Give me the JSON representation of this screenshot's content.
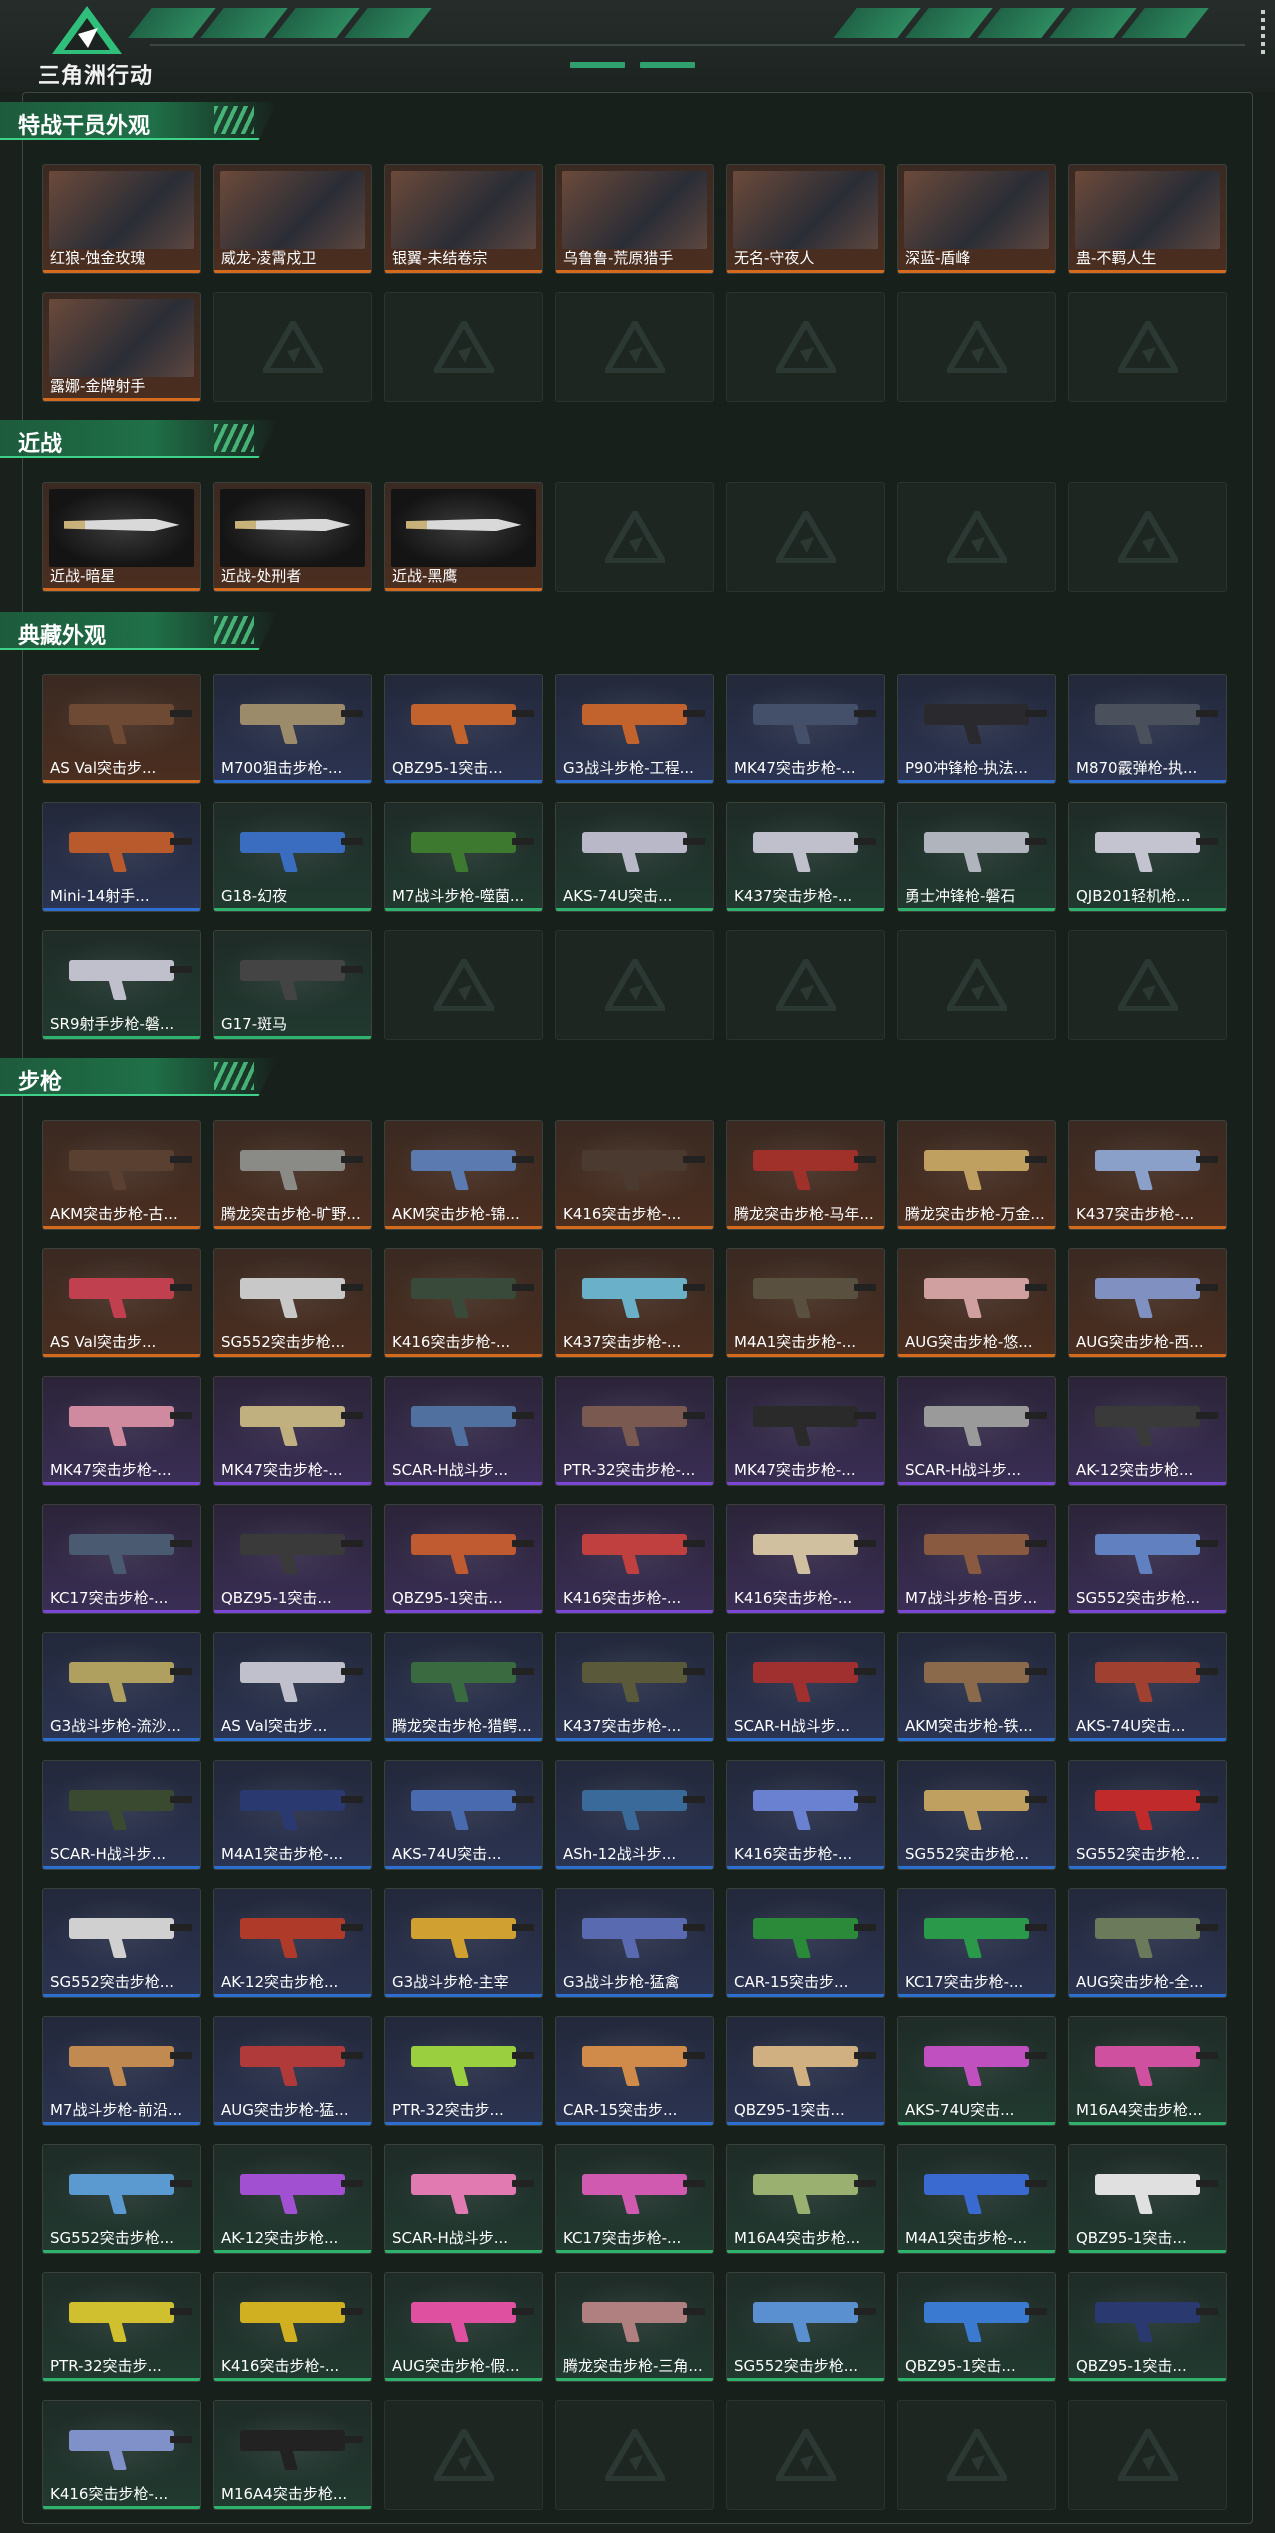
{
  "header": {
    "brand": "三角洲行动",
    "logo_icon": "delta-logo-icon"
  },
  "sections": [
    {
      "title": "特战干员外观",
      "items": [
        {
          "name": "红狼-蚀金玫瑰",
          "quality": "orange",
          "kind": "operator"
        },
        {
          "name": "威龙-凌霄戍卫",
          "quality": "orange",
          "kind": "operator"
        },
        {
          "name": "银翼-未结卷宗",
          "quality": "orange",
          "kind": "operator"
        },
        {
          "name": "乌鲁鲁-荒原猎手",
          "quality": "orange",
          "kind": "operator"
        },
        {
          "name": "无名-守夜人",
          "quality": "orange",
          "kind": "operator"
        },
        {
          "name": "深蓝-盾峰",
          "quality": "orange",
          "kind": "operator"
        },
        {
          "name": "蛊-不羁人生",
          "quality": "orange",
          "kind": "operator"
        },
        {
          "name": "露娜-金牌射手",
          "quality": "orange",
          "kind": "operator"
        }
      ],
      "slots": 14
    },
    {
      "title": "近战",
      "items": [
        {
          "name": "近战-暗星",
          "quality": "orange",
          "kind": "melee"
        },
        {
          "name": "近战-处刑者",
          "quality": "orange",
          "kind": "melee"
        },
        {
          "name": "近战-黑鹰",
          "quality": "orange",
          "kind": "melee"
        }
      ],
      "slots": 7
    },
    {
      "title": "典藏外观",
      "items": [
        {
          "name": "AS Val突击步...",
          "quality": "orange",
          "kind": "gun",
          "color": "#6e4a34"
        },
        {
          "name": "M700狙击步枪-...",
          "quality": "blue",
          "kind": "gun",
          "color": "#9c8b6a"
        },
        {
          "name": "QBZ95-1突击...",
          "quality": "blue",
          "kind": "gun",
          "color": "#c2622c"
        },
        {
          "name": "G3战斗步枪-工程...",
          "quality": "blue",
          "kind": "gun",
          "color": "#c2622c"
        },
        {
          "name": "MK47突击步枪-...",
          "quality": "blue",
          "kind": "gun",
          "color": "#44506a"
        },
        {
          "name": "P90冲锋枪-执法...",
          "quality": "blue",
          "kind": "gun",
          "color": "#2a2a2e"
        },
        {
          "name": "M870霰弹枪-执...",
          "quality": "blue",
          "kind": "gun",
          "color": "#4a505c"
        },
        {
          "name": "Mini-14射手...",
          "quality": "blue",
          "kind": "gun",
          "color": "#b85a2c"
        },
        {
          "name": "G18-幻夜",
          "quality": "green",
          "kind": "gun",
          "color": "#3a6cc0"
        },
        {
          "name": "M7战斗步枪-噬菌...",
          "quality": "green",
          "kind": "gun",
          "color": "#3d7a30"
        },
        {
          "name": "AKS-74U突击...",
          "quality": "green",
          "kind": "gun",
          "color": "#b8b8c8"
        },
        {
          "name": "K437突击步枪-...",
          "quality": "green",
          "kind": "gun",
          "color": "#c0c0cc"
        },
        {
          "name": "勇士冲锋枪-磐石",
          "quality": "green",
          "kind": "gun",
          "color": "#b0b4bc"
        },
        {
          "name": "QJB201轻机枪...",
          "quality": "green",
          "kind": "gun",
          "color": "#c4c4d0"
        },
        {
          "name": "SR9射手步枪-磐...",
          "quality": "green",
          "kind": "gun",
          "color": "#c0c0cc"
        },
        {
          "name": "G17-斑马",
          "quality": "green",
          "kind": "gun",
          "color": "#444444"
        }
      ],
      "slots": 21
    },
    {
      "title": "步枪",
      "items": [
        {
          "name": "AKM突击步枪-古...",
          "quality": "orange",
          "kind": "gun",
          "color": "#5a4030"
        },
        {
          "name": "腾龙突击步枪-旷野...",
          "quality": "orange",
          "kind": "gun",
          "color": "#8a8a86"
        },
        {
          "name": "AKM突击步枪-锦...",
          "quality": "orange",
          "kind": "gun",
          "color": "#5a7ab0"
        },
        {
          "name": "K416突击步枪-...",
          "quality": "orange",
          "kind": "gun",
          "color": "#4a3a30"
        },
        {
          "name": "腾龙突击步枪-马年...",
          "quality": "orange",
          "kind": "gun",
          "color": "#a0302a"
        },
        {
          "name": "腾龙突击步枪-万金...",
          "quality": "orange",
          "kind": "gun",
          "color": "#c0a060"
        },
        {
          "name": "K437突击步枪-...",
          "quality": "orange",
          "kind": "gun",
          "color": "#8aa0c8"
        },
        {
          "name": "AS Val突击步...",
          "quality": "orange",
          "kind": "gun",
          "color": "#c04050"
        },
        {
          "name": "SG552突击步枪...",
          "quality": "orange",
          "kind": "gun",
          "color": "#c8c8c8"
        },
        {
          "name": "K416突击步枪-...",
          "quality": "orange",
          "kind": "gun",
          "color": "#3a4a3a"
        },
        {
          "name": "K437突击步枪-...",
          "quality": "orange",
          "kind": "gun",
          "color": "#6ab0c8"
        },
        {
          "name": "M4A1突击步枪-...",
          "quality": "orange",
          "kind": "gun",
          "color": "#5a5040"
        },
        {
          "name": "AUG突击步枪-悠...",
          "quality": "orange",
          "kind": "gun",
          "color": "#d0a0a0"
        },
        {
          "name": "AUG突击步枪-西...",
          "quality": "orange",
          "kind": "gun",
          "color": "#8090c0"
        },
        {
          "name": "MK47突击步枪-...",
          "quality": "purple",
          "kind": "gun",
          "color": "#d08aa0"
        },
        {
          "name": "MK47突击步枪-...",
          "quality": "purple",
          "kind": "gun",
          "color": "#c0b080"
        },
        {
          "name": "SCAR-H战斗步...",
          "quality": "purple",
          "kind": "gun",
          "color": "#5070a0"
        },
        {
          "name": "PTR-32突击步枪-...",
          "quality": "purple",
          "kind": "gun",
          "color": "#7a5a50"
        },
        {
          "name": "MK47突击步枪-...",
          "quality": "purple",
          "kind": "gun",
          "color": "#2a2a2a"
        },
        {
          "name": "SCAR-H战斗步...",
          "quality": "purple",
          "kind": "gun",
          "color": "#9a9a9a"
        },
        {
          "name": "AK-12突击步枪...",
          "quality": "purple",
          "kind": "gun",
          "color": "#3a3a3a"
        },
        {
          "name": "KC17突击步枪-...",
          "quality": "purple",
          "kind": "gun",
          "color": "#4a5a70"
        },
        {
          "name": "QBZ95-1突击...",
          "quality": "purple",
          "kind": "gun",
          "color": "#3a3a3a"
        },
        {
          "name": "QBZ95-1突击...",
          "quality": "purple",
          "kind": "gun",
          "color": "#c05a30"
        },
        {
          "name": "K416突击步枪-...",
          "quality": "purple",
          "kind": "gun",
          "color": "#c04040"
        },
        {
          "name": "K416突击步枪-...",
          "quality": "purple",
          "kind": "gun",
          "color": "#d0c0a0"
        },
        {
          "name": "M7战斗步枪-百步...",
          "quality": "purple",
          "kind": "gun",
          "color": "#8a5a40"
        },
        {
          "name": "SG552突击步枪...",
          "quality": "purple",
          "kind": "gun",
          "color": "#6080c0"
        },
        {
          "name": "G3战斗步枪-流沙...",
          "quality": "blue",
          "kind": "gun",
          "color": "#b0a060"
        },
        {
          "name": "AS Val突击步...",
          "quality": "blue",
          "kind": "gun",
          "color": "#c0c0cc"
        },
        {
          "name": "腾龙突击步枪-猎鳄...",
          "quality": "blue",
          "kind": "gun",
          "color": "#3a6a40"
        },
        {
          "name": "K437突击步枪-...",
          "quality": "blue",
          "kind": "gun",
          "color": "#5a5a3a"
        },
        {
          "name": "SCAR-H战斗步...",
          "quality": "blue",
          "kind": "gun",
          "color": "#a03030"
        },
        {
          "name": "AKM突击步枪-铁...",
          "quality": "blue",
          "kind": "gun",
          "color": "#8a6a4a"
        },
        {
          "name": "AKS-74U突击...",
          "quality": "blue",
          "kind": "gun",
          "color": "#a04030"
        },
        {
          "name": "SCAR-H战斗步...",
          "quality": "blue",
          "kind": "gun",
          "color": "#3a4a30"
        },
        {
          "name": "M4A1突击步枪-...",
          "quality": "blue",
          "kind": "gun",
          "color": "#2a3a70"
        },
        {
          "name": "AKS-74U突击...",
          "quality": "blue",
          "kind": "gun",
          "color": "#4a6ab0"
        },
        {
          "name": "ASh-12战斗步...",
          "quality": "blue",
          "kind": "gun",
          "color": "#3a6a9a"
        },
        {
          "name": "K416突击步枪-...",
          "quality": "blue",
          "kind": "gun",
          "color": "#6a80d0"
        },
        {
          "name": "SG552突击步枪...",
          "quality": "blue",
          "kind": "gun",
          "color": "#c0a060"
        },
        {
          "name": "SG552突击步枪...",
          "quality": "blue",
          "kind": "gun",
          "color": "#c02a2a"
        },
        {
          "name": "SG552突击步枪...",
          "quality": "blue",
          "kind": "gun",
          "color": "#d0d0d0"
        },
        {
          "name": "AK-12突击步枪...",
          "quality": "blue",
          "kind": "gun",
          "color": "#b03a2a"
        },
        {
          "name": "G3战斗步枪-主宰",
          "quality": "blue",
          "kind": "gun",
          "color": "#d0a030"
        },
        {
          "name": "G3战斗步枪-猛禽",
          "quality": "blue",
          "kind": "gun",
          "color": "#5a6ab0"
        },
        {
          "name": "CAR-15突击步...",
          "quality": "blue",
          "kind": "gun",
          "color": "#2a8a3a"
        },
        {
          "name": "KC17突击步枪-...",
          "quality": "blue",
          "kind": "gun",
          "color": "#2a9a4a"
        },
        {
          "name": "AUG突击步枪-全...",
          "quality": "blue",
          "kind": "gun",
          "color": "#6a7a5a"
        },
        {
          "name": "M7战斗步枪-前沿...",
          "quality": "blue",
          "kind": "gun",
          "color": "#c08a50"
        },
        {
          "name": "AUG突击步枪-猛...",
          "quality": "blue",
          "kind": "gun",
          "color": "#b03a3a"
        },
        {
          "name": "PTR-32突击步...",
          "quality": "blue",
          "kind": "gun",
          "color": "#9ad040"
        },
        {
          "name": "CAR-15突击步...",
          "quality": "blue",
          "kind": "gun",
          "color": "#d08a4a"
        },
        {
          "name": "QBZ95-1突击...",
          "quality": "blue",
          "kind": "gun",
          "color": "#d0b080"
        },
        {
          "name": "AKS-74U突击...",
          "quality": "green",
          "kind": "gun",
          "color": "#c050c0"
        },
        {
          "name": "M16A4突击步枪...",
          "quality": "green",
          "kind": "gun",
          "color": "#d050a0"
        },
        {
          "name": "SG552突击步枪...",
          "quality": "green",
          "kind": "gun",
          "color": "#5a9ad0"
        },
        {
          "name": "AK-12突击步枪...",
          "quality": "green",
          "kind": "gun",
          "color": "#a050d0"
        },
        {
          "name": "SCAR-H战斗步...",
          "quality": "green",
          "kind": "gun",
          "color": "#e07ab0"
        },
        {
          "name": "KC17突击步枪-...",
          "quality": "green",
          "kind": "gun",
          "color": "#d05ab0"
        },
        {
          "name": "M16A4突击步枪...",
          "quality": "green",
          "kind": "gun",
          "color": "#9ab070"
        },
        {
          "name": "M4A1突击步枪-...",
          "quality": "green",
          "kind": "gun",
          "color": "#3a6ad0"
        },
        {
          "name": "QBZ95-1突击...",
          "quality": "green",
          "kind": "gun",
          "color": "#e0e0e0"
        },
        {
          "name": "PTR-32突击步...",
          "quality": "green",
          "kind": "gun",
          "color": "#d0c030"
        },
        {
          "name": "K416突击步枪-...",
          "quality": "green",
          "kind": "gun",
          "color": "#d0b020"
        },
        {
          "name": "AUG突击步枪-假...",
          "quality": "green",
          "kind": "gun",
          "color": "#e050a0"
        },
        {
          "name": "腾龙突击步枪-三角...",
          "quality": "green",
          "kind": "gun",
          "color": "#b08080"
        },
        {
          "name": "SG552突击步枪...",
          "quality": "green",
          "kind": "gun",
          "color": "#5a90d0"
        },
        {
          "name": "QBZ95-1突击...",
          "quality": "green",
          "kind": "gun",
          "color": "#3a7ad0"
        },
        {
          "name": "QBZ95-1突击...",
          "quality": "green",
          "kind": "gun",
          "color": "#2a3a70"
        },
        {
          "name": "K416突击步枪-...",
          "quality": "green",
          "kind": "gun",
          "color": "#8090c8"
        },
        {
          "name": "M16A4突击步枪...",
          "quality": "green",
          "kind": "gun",
          "color": "#222222"
        }
      ],
      "slots": 77
    }
  ],
  "colors": {
    "orange": "#d46a1e",
    "blue": "#2c6fd0",
    "purple": "#7b46d6",
    "green": "#2fb36c",
    "accent": "#30a06e"
  }
}
